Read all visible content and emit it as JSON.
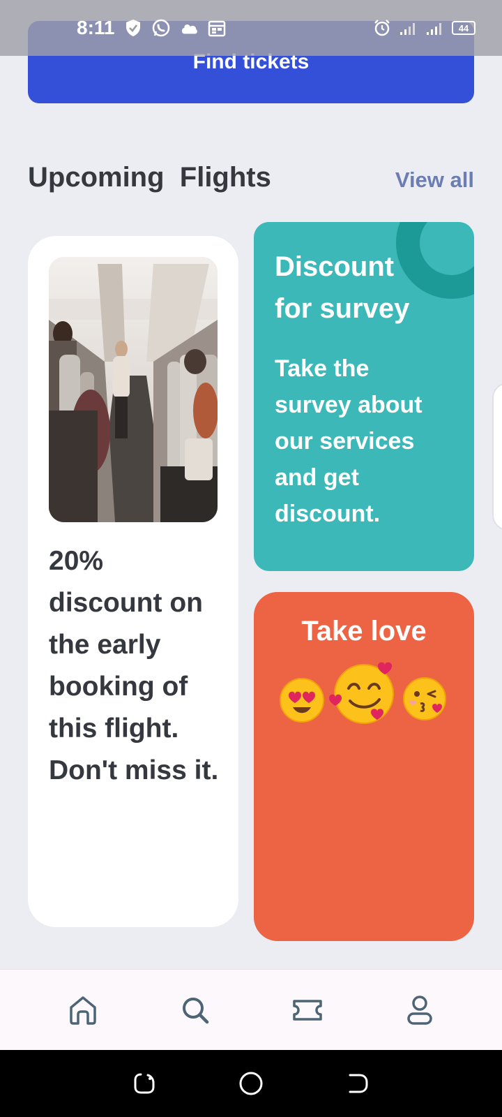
{
  "status_bar": {
    "time": "8:11",
    "battery": "44",
    "icons": [
      "shield-check-icon",
      "whatsapp-icon",
      "cloud-icon",
      "calendar-icon",
      "alarm-icon",
      "signal-icon",
      "signal-icon",
      "battery-icon"
    ]
  },
  "find_tickets": {
    "label": "Find tickets"
  },
  "section": {
    "title": "Upcoming  Flights",
    "view_all": "View all"
  },
  "cards": {
    "promo": {
      "image": "airplane-cabin-photo",
      "text": "20% discount on the early booking of this flight. Don't miss it."
    },
    "survey": {
      "title": "Discount for survey",
      "body": "Take the survey about our services and get discount."
    },
    "love": {
      "title": "Take love",
      "emojis": [
        "heart-eyes-emoji",
        "smiling-face-with-hearts-emoji",
        "kissing-face-emoji"
      ]
    }
  },
  "bottom_nav": {
    "items": [
      "home-icon",
      "search-icon",
      "ticket-icon",
      "profile-icon"
    ]
  },
  "system_nav": {
    "items": [
      "recents-button",
      "home-button",
      "back-button"
    ]
  },
  "colors": {
    "background": "#ecedf2",
    "primary": "#3550d8",
    "teal": "#3bb8b7",
    "teal_dark": "#1b9a98",
    "orange": "#ec6444",
    "text_dark": "#36383f",
    "link": "#6b7db3",
    "nav_icon": "#4d6475"
  }
}
